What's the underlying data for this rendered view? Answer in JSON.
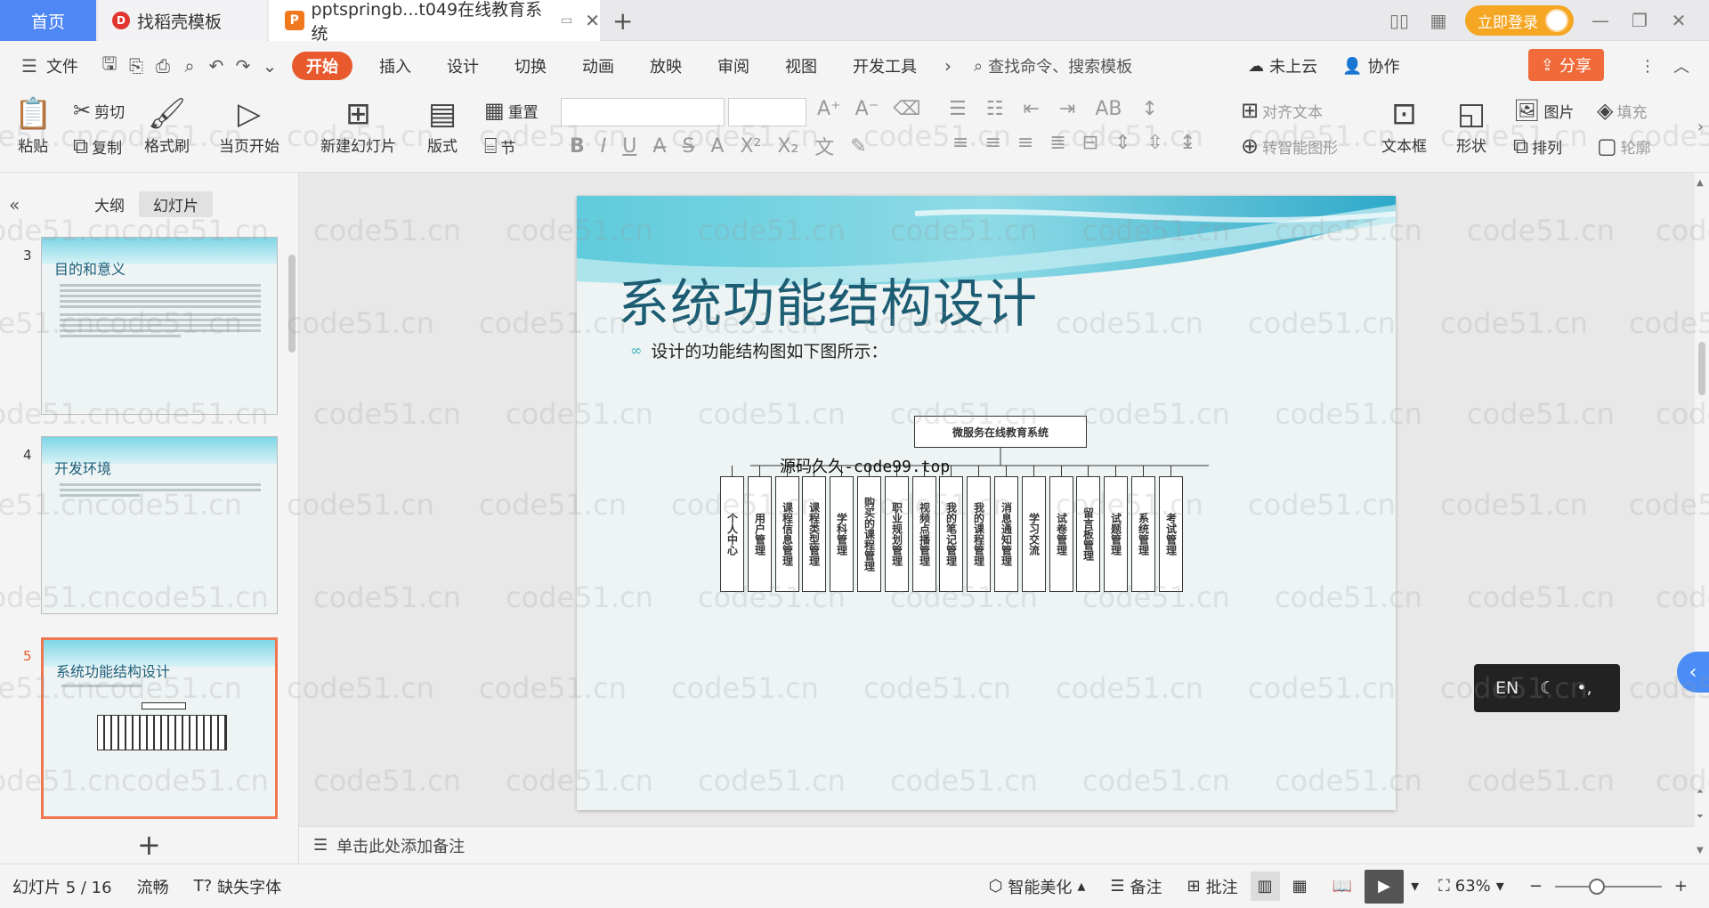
{
  "tabs": {
    "home": "首页",
    "docer": "找稻壳模板",
    "document": "pptspringb...t049在线教育系统"
  },
  "titlebar": {
    "login": "立即登录"
  },
  "menu": {
    "file": "文件",
    "items": [
      "开始",
      "插入",
      "设计",
      "切换",
      "动画",
      "放映",
      "审阅",
      "视图",
      "开发工具"
    ],
    "search_placeholder": "查找命令、搜索模板",
    "cloud": "未上云",
    "collab": "协作",
    "share": "分享"
  },
  "ribbon": {
    "paste": "粘贴",
    "cut": "剪切",
    "copy": "复制",
    "format_painter": "格式刷",
    "from_current": "当页开始",
    "new_slide": "新建幻灯片",
    "layout": "版式",
    "section": "节",
    "reset": "重置",
    "align_text": "对齐文本",
    "smart_shape": "转智能图形",
    "textbox": "文本框",
    "shape": "形状",
    "picture": "图片",
    "arrange": "排列",
    "fill": "填充",
    "outline": "轮廓"
  },
  "left_panel": {
    "tab_outline": "大纲",
    "tab_slides": "幻灯片",
    "thumbs": [
      {
        "num": "3",
        "title": "目的和意义"
      },
      {
        "num": "4",
        "title": "开发环境"
      },
      {
        "num": "5",
        "title": "系统功能结构设计"
      }
    ]
  },
  "slide": {
    "title": "系统功能结构设计",
    "bullet": "设计的功能结构图如下图所示：",
    "root": "微服务在线教育系统",
    "watermark_text": "源码久久-code99.top",
    "children": [
      "个人中心",
      "用户管理",
      "课程信息管理",
      "课程类型管理",
      "学科管理",
      "购买的课程管理",
      "职业规划管理",
      "视频点播管理",
      "我的笔记管理",
      "我的课程管理",
      "消息通知管理",
      "学习交流",
      "试卷管理",
      "留言板管理",
      "试题管理",
      "系统管理",
      "考试管理"
    ]
  },
  "notes": {
    "placeholder": "单击此处添加备注"
  },
  "ime": {
    "lang": "EN"
  },
  "status": {
    "slide_pos": "幻灯片 5 / 16",
    "smooth": "流畅",
    "missing_font": "缺失字体",
    "beautify": "智能美化",
    "notes": "备注",
    "comment": "批注",
    "zoom": "63%"
  },
  "watermark": "code51.cn",
  "colors": {
    "accent": "#e85a2e",
    "home_tab": "#4f87f5",
    "title": "#1c5d73"
  }
}
